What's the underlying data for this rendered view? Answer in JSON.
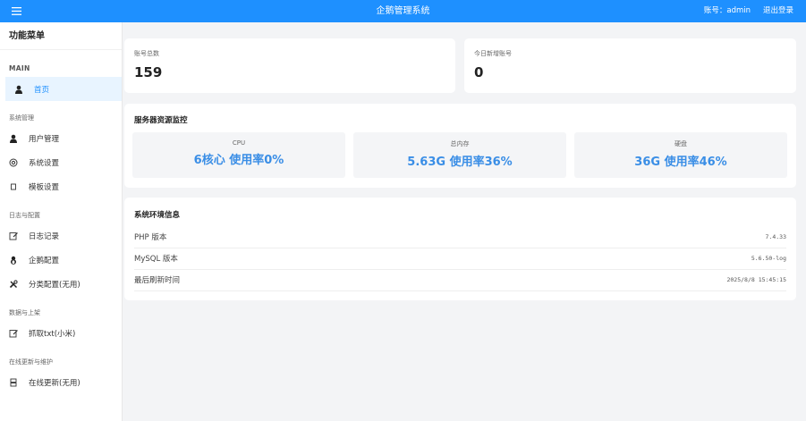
{
  "header": {
    "menu_icon": "hamburger-icon",
    "title": "企鹅管理系统",
    "account_text": "账号：admin",
    "logout_label": "退出登录",
    "accent_color": "#1e90ff"
  },
  "sidebar": {
    "title": "功能菜单",
    "main_label": "MAIN",
    "home": {
      "label": "首页",
      "icon": "user-icon"
    },
    "groups": [
      {
        "label": "系统管理",
        "items": [
          {
            "label": "用户管理",
            "icon": "user-icon"
          },
          {
            "label": "系统设置",
            "icon": "gear-icon"
          },
          {
            "label": "模板设置",
            "icon": "template-icon"
          }
        ]
      },
      {
        "label": "日志与配置",
        "items": [
          {
            "label": "日志记录",
            "icon": "edit-icon"
          },
          {
            "label": "企鹅配置",
            "icon": "penguin-icon"
          },
          {
            "label": "分类配置(无用)",
            "icon": "tools-icon"
          }
        ]
      },
      {
        "label": "数据与上架",
        "items": [
          {
            "label": "抓取txt(小米)",
            "icon": "edit-icon"
          }
        ]
      },
      {
        "label": "在线更新与维护",
        "items": [
          {
            "label": "在线更新(无用)",
            "icon": "server-icon"
          }
        ]
      }
    ]
  },
  "stats": {
    "total_accounts": {
      "label": "账号总数",
      "value": "159"
    },
    "new_today": {
      "label": "今日新增账号",
      "value": "0"
    }
  },
  "monitor": {
    "title": "服务器资源监控",
    "cpu": {
      "label": "CPU",
      "value": "6核心 使用率0%"
    },
    "memory": {
      "label": "总内存",
      "value": "5.63G 使用率36%"
    },
    "disk": {
      "label": "硬盘",
      "value": "36G 使用率46%"
    }
  },
  "env": {
    "title": "系统环境信息",
    "rows": [
      {
        "key": "PHP 版本",
        "value": "7.4.33"
      },
      {
        "key": "MySQL 版本",
        "value": "5.6.50-log"
      },
      {
        "key": "最后刷新时间",
        "value": "2025/8/8 15:45:15"
      }
    ]
  }
}
